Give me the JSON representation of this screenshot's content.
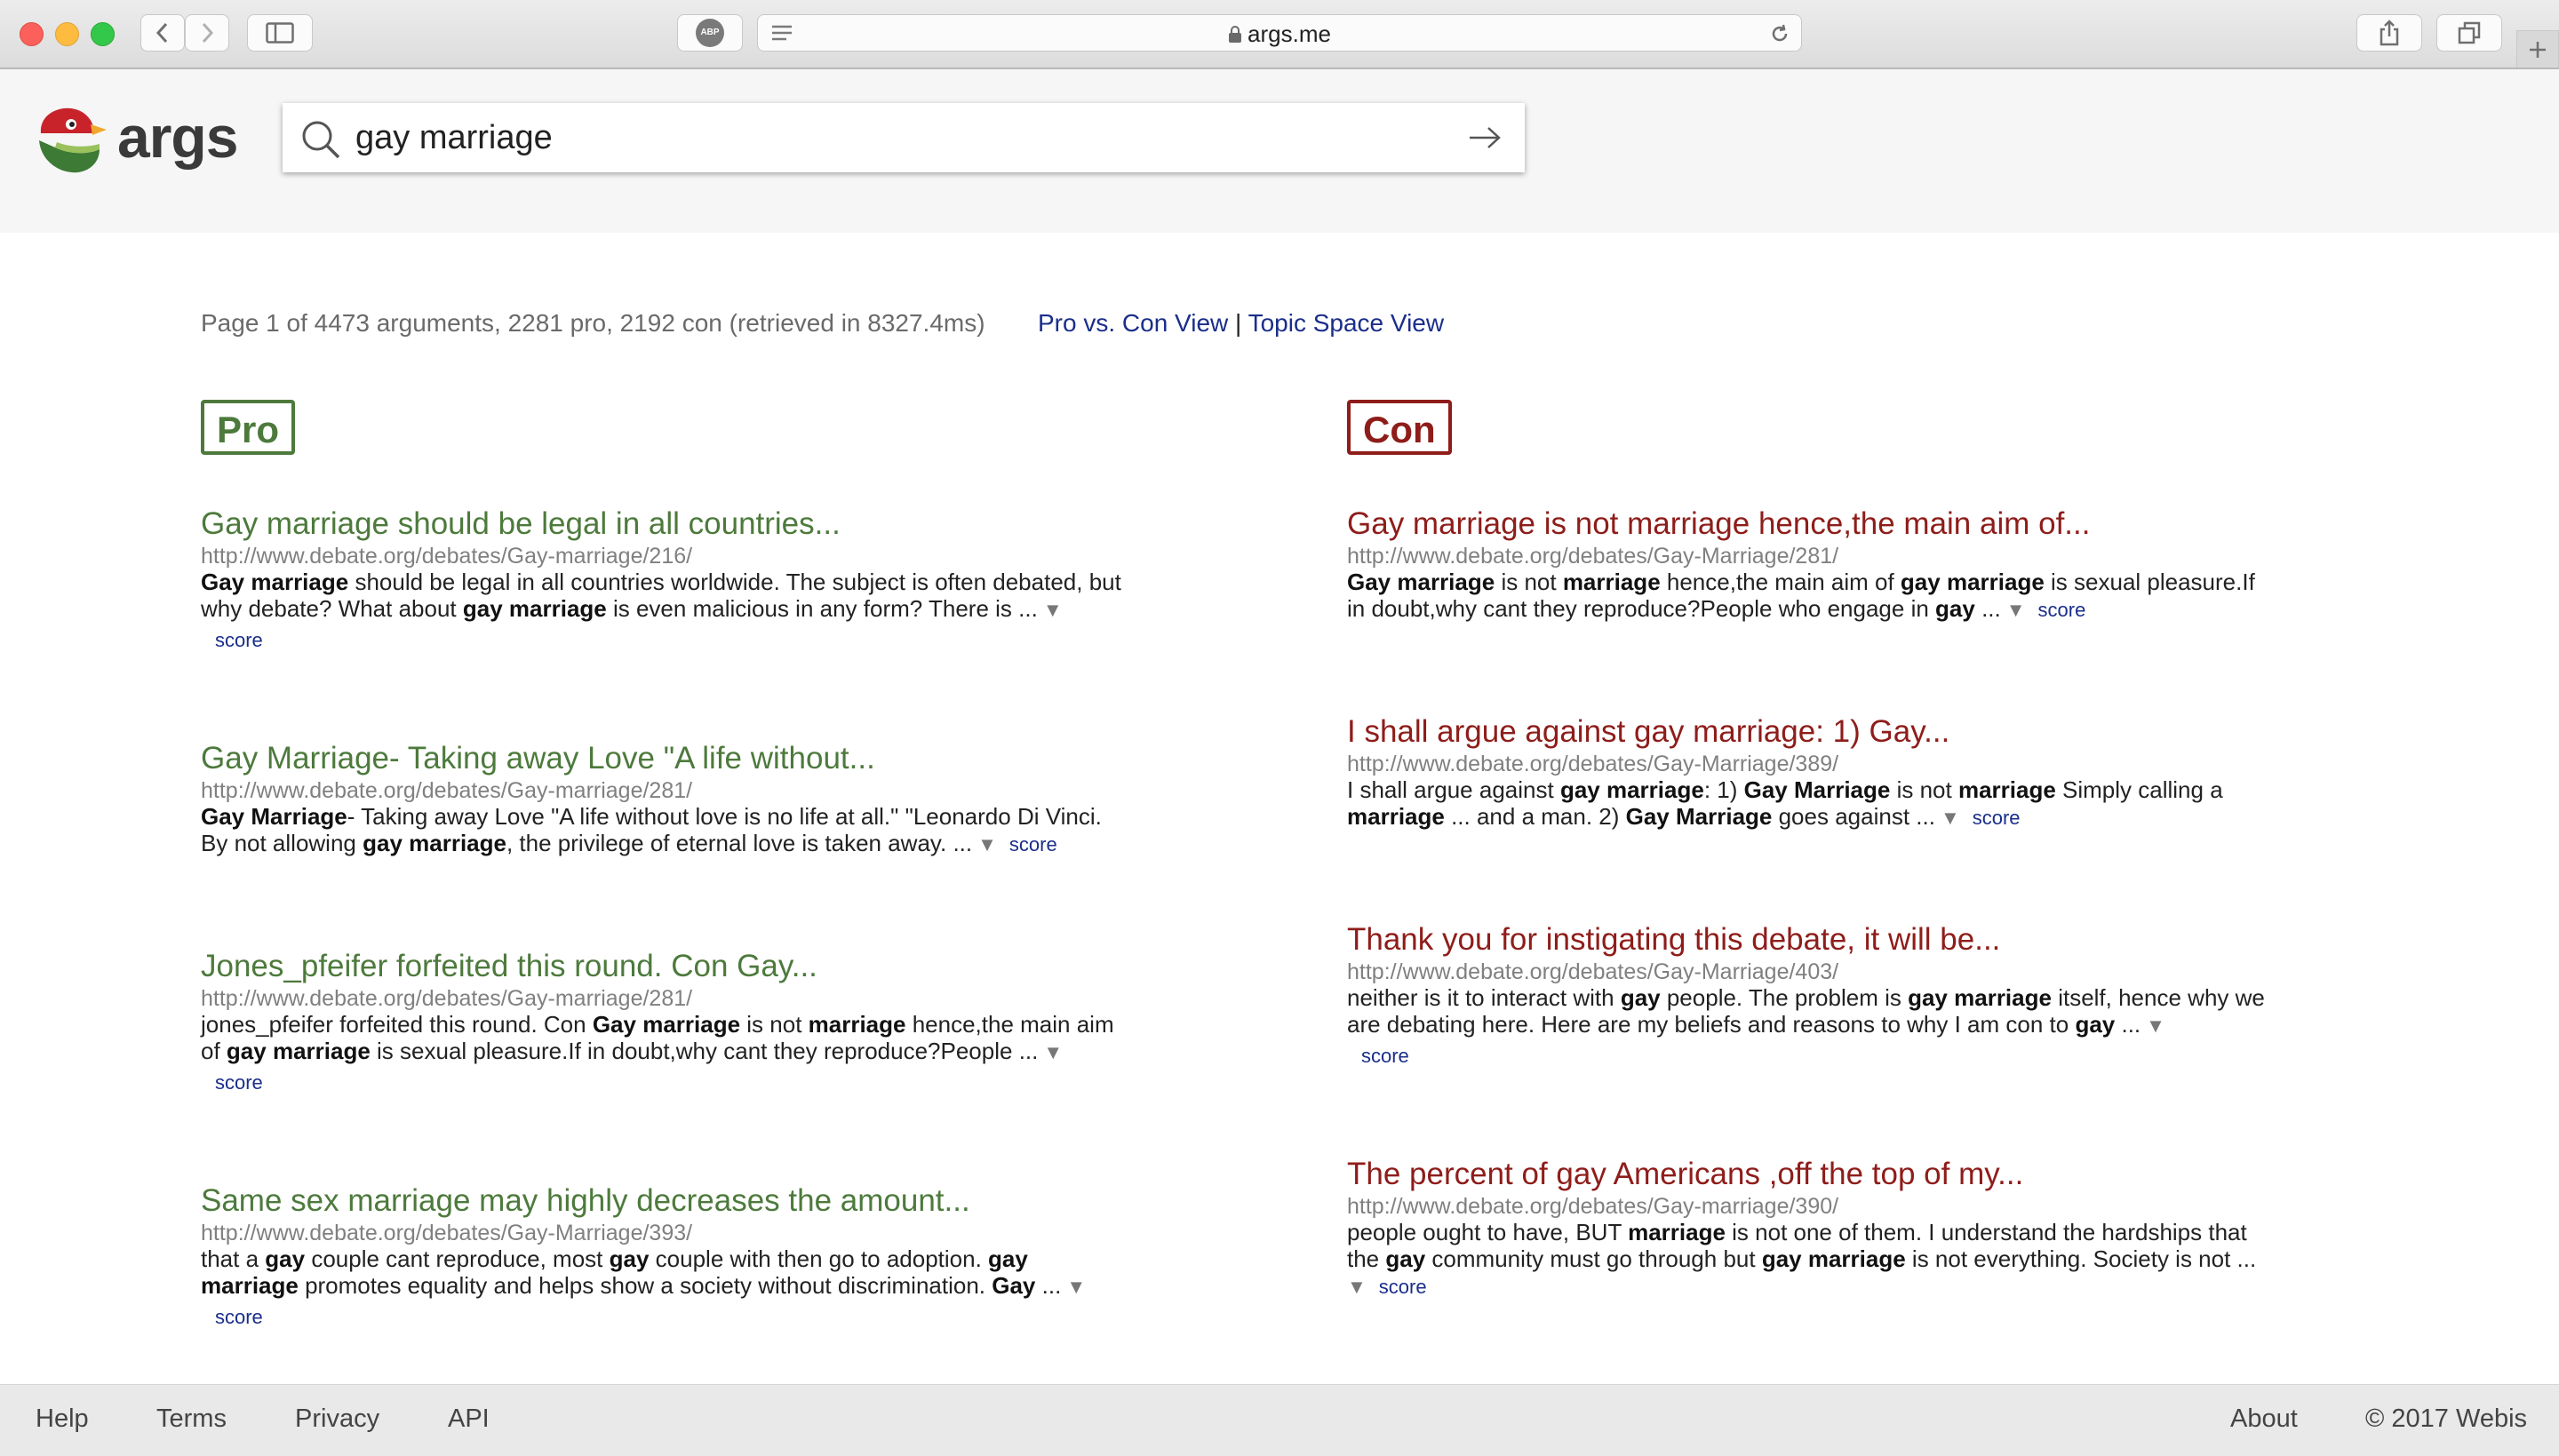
{
  "browser": {
    "url": "args.me",
    "abp_label": "ABP"
  },
  "site": {
    "logo_text": "args",
    "search_value": "gay marriage"
  },
  "results_header": {
    "summary": "Page 1 of 4473 arguments, 2281 pro, 2192 con (retrieved in 8327.4ms)",
    "view_pro_con": "Pro vs. Con View",
    "separator": "|",
    "view_topic_space": "Topic Space View"
  },
  "pro": {
    "label": "Pro",
    "results": [
      {
        "title": "Gay marriage should be legal in all countries...",
        "url": "http://www.debate.org/debates/Gay-marriage/216/",
        "snippet_html": "<b>Gay marriage</b> should be legal in all countries worldwide. The subject is often debated, but why debate? What about <b>gay marriage</b> is even malicious in any form? There is ...",
        "score_label": "score"
      },
      {
        "title": "Gay Marriage- Taking away Love \"A life without...",
        "url": "http://www.debate.org/debates/Gay-marriage/281/",
        "snippet_html": "<b>Gay Marriage</b>- Taking away Love \"A life without love is no life at all.\" \"Leonardo Di Vinci. By not allowing <b>gay marriage</b>, the privilege of eternal love is taken away. ...",
        "score_label": "score"
      },
      {
        "title": "Jones_pfeifer forfeited this round. Con Gay...",
        "url": "http://www.debate.org/debates/Gay-marriage/281/",
        "snippet_html": "jones_pfeifer forfeited this round. Con <b>Gay marriage</b> is not <b>marriage</b> hence,the main aim of <b>gay marriage</b> is sexual pleasure.If in doubt,why cant they reproduce?People ...",
        "score_label": "score"
      },
      {
        "title": "Same sex marriage may highly decreases the amount...",
        "url": "http://www.debate.org/debates/Gay-Marriage/393/",
        "snippet_html": "that a <b>gay</b> couple cant reproduce, most <b>gay</b> couple with then go to adoption. <b>gay marriage</b> promotes equality and helps show a society without discrimination. <b>Gay</b> ...",
        "score_label": "score"
      }
    ]
  },
  "con": {
    "label": "Con",
    "results": [
      {
        "title": "Gay marriage is not marriage hence,the main aim of...",
        "url": "http://www.debate.org/debates/Gay-Marriage/281/",
        "snippet_html": "<b>Gay marriage</b> is not <b>marriage</b> hence,the main aim of <b>gay marriage</b> is sexual pleasure.If in doubt,why cant they reproduce?People who engage in <b>gay</b> ...",
        "score_label": "score"
      },
      {
        "title": "I shall argue against gay marriage: 1) Gay...",
        "url": "http://www.debate.org/debates/Gay-Marriage/389/",
        "snippet_html": "I shall argue against <b>gay marriage</b>: 1) <b>Gay Marriage</b> is not <b>marriage</b> Simply calling a <b>marriage</b> ... and a man. 2) <b>Gay Marriage</b> goes against ...",
        "score_label": "score"
      },
      {
        "title": "Thank you for instigating this debate, it will be...",
        "url": "http://www.debate.org/debates/Gay-Marriage/403/",
        "snippet_html": "neither is it to interact with <b>gay</b> people. The problem is <b>gay marriage</b> itself, hence why we are debating here. Here are my beliefs and reasons to why I am con to <b>gay</b> ...",
        "score_label": "score"
      },
      {
        "title": "The percent of gay Americans ,off the top of my...",
        "url": "http://www.debate.org/debates/Gay-marriage/390/",
        "snippet_html": "people ought to have, BUT <b>marriage</b> is not one of them. I understand the hardships that the <b>gay</b> community must go through but <b>gay marriage</b> is not everything. Society is not ...",
        "score_label": "score"
      }
    ]
  },
  "footer": {
    "help": "Help",
    "terms": "Terms",
    "privacy": "Privacy",
    "api": "API",
    "about": "About",
    "copyright": "© 2017 Webis"
  },
  "colors": {
    "pro": "#4d7a3c",
    "con": "#8e1d1a",
    "link": "#1a2e8a"
  }
}
